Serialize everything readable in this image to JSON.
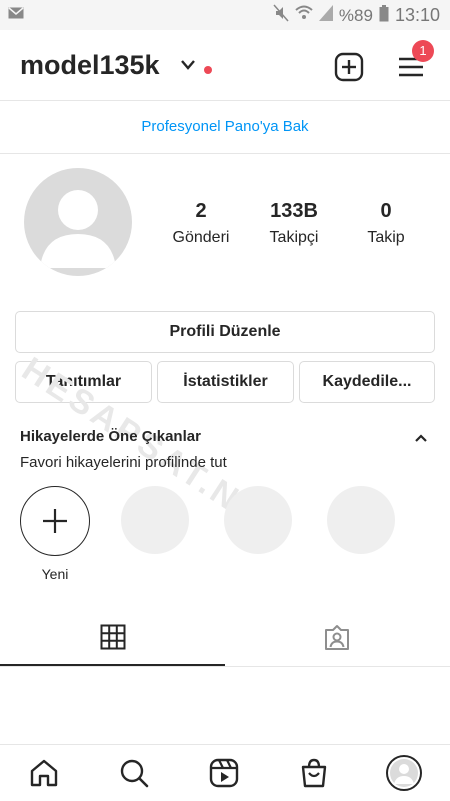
{
  "status_bar": {
    "battery": "%89",
    "time": "13:10"
  },
  "header": {
    "username": "model135k",
    "notification_count": "1"
  },
  "professional_dashboard": {
    "label": "Profesyonel Pano'ya Bak"
  },
  "profile": {
    "stats": [
      {
        "value": "2",
        "label": "Gönderi"
      },
      {
        "value": "133B",
        "label": "Takipçi"
      },
      {
        "value": "0",
        "label": "Takip"
      }
    ]
  },
  "actions": {
    "edit_profile": "Profili Düzenle",
    "promotions": "Tanıtımlar",
    "insights": "İstatistikler",
    "saved": "Kaydedile..."
  },
  "highlights": {
    "title": "Hikayelerde Öne Çıkanlar",
    "subtitle": "Favori hikayelerini profilinde tut",
    "new_label": "Yeni"
  },
  "watermark": {
    "text": "HESAPSAT.NET"
  },
  "colors": {
    "accent_blue": "#0095f6",
    "badge_red": "#ed4956",
    "border": "#dbdbdb"
  }
}
